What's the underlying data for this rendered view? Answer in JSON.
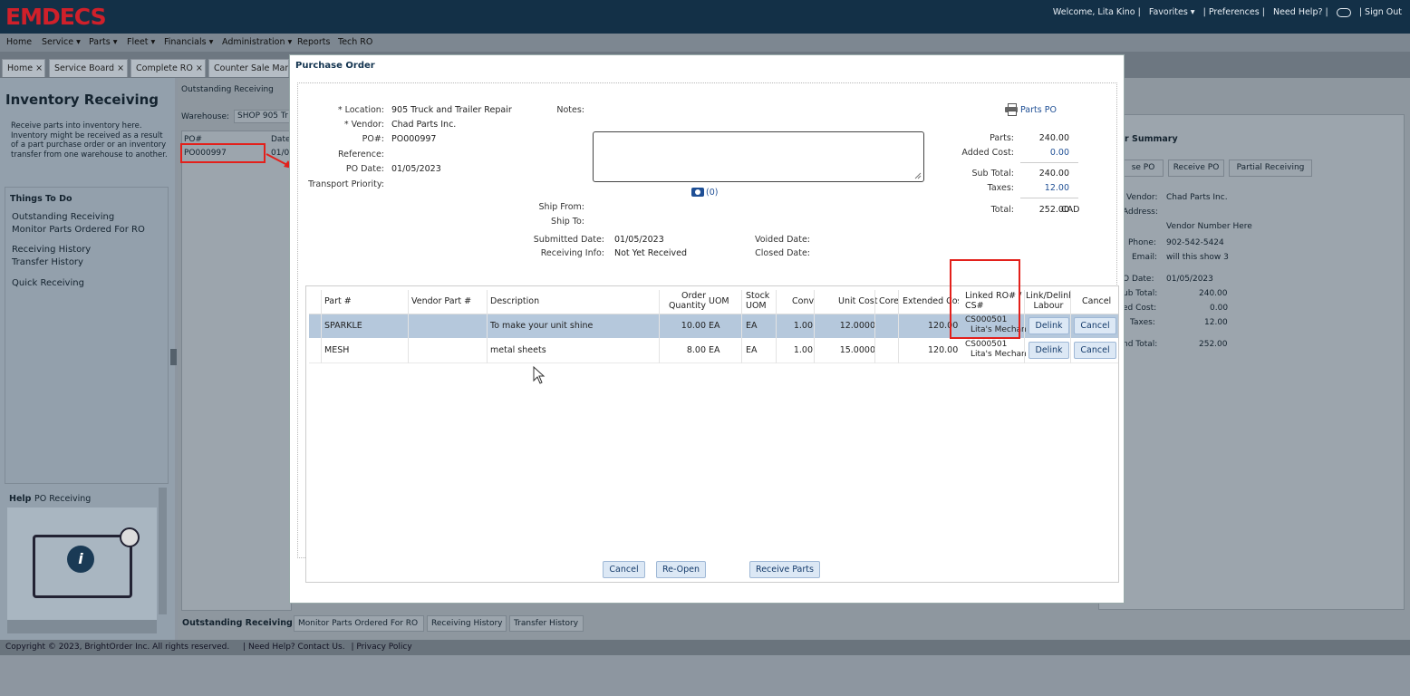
{
  "app": {
    "logo": "EMDECS"
  },
  "header": {
    "welcome": "Welcome, Lita Kino |",
    "favorites": "Favorites ▾",
    "preferences": "| Preferences |",
    "help": "Need Help? |",
    "signout": "| Sign Out"
  },
  "nav": [
    "Home",
    "Service ▾",
    "Parts ▾",
    "Fleet ▾",
    "Financials ▾",
    "Administration ▾",
    "Reports",
    "Tech RO"
  ],
  "tabs": [
    "Home ×",
    "Service Board ×",
    "Complete RO ×",
    "Counter Sale Mana"
  ],
  "left": {
    "title": "Inventory Receiving",
    "intro": "Receive parts into inventory here. Inventory might be received as a result of a part purchase order or an inventory transfer from one warehouse to another.",
    "things_title": "Things To Do",
    "links": [
      "Outstanding Receiving",
      "Monitor Parts Ordered For RO",
      "Receiving History",
      "Transfer History",
      "Quick Receiving"
    ],
    "help_title": "Help",
    "help_topic": "PO Receiving"
  },
  "main": {
    "radio_label": "Outstanding Receiving",
    "warehouse_label": "Warehouse:",
    "warehouse_value": "SHOP 905 Tr",
    "col_po": "PO#",
    "col_date": "Date",
    "po_value": "PO000997",
    "date_value": "01/0",
    "bottom_tabs": [
      "Outstanding Receiving",
      "Monitor Parts Ordered For RO",
      "Receiving History",
      "Transfer History"
    ]
  },
  "summary": {
    "title": "r Summary",
    "buttons": [
      "se PO",
      "Receive PO",
      "Partial Receiving"
    ],
    "vendor_label": "Vendor:",
    "vendor_value": "Chad Parts Inc.",
    "address_label": "Address:",
    "vendor_number": "Vendor Number Here",
    "phone_label": "Phone:",
    "phone_value": "902-542-5424",
    "email_label": "Email:",
    "email_value": "will this show 3",
    "podate_label": "O Date:",
    "podate_value": "01/05/2023",
    "subtotal_label": "ub Total:",
    "subtotal_value": "240.00",
    "addcost_label": "ed Cost:",
    "addcost_value": "0.00",
    "taxes_label": "Taxes:",
    "taxes_value": "12.00",
    "grand_label": "nd Total:",
    "grand_value": "252.00"
  },
  "footer": {
    "copyright": "Copyright © 2023, BrightOrder Inc. All rights reserved.",
    "help": "| Need Help? Contact Us.",
    "privacy": "| Privacy Policy"
  },
  "modal": {
    "title": "Purchase Order",
    "location_label": "* Location:",
    "location_value": "905 Truck and Trailer Repair",
    "vendor_label": "* Vendor:",
    "vendor_value": "Chad Parts Inc.",
    "po_label": "PO#:",
    "po_value": "PO000997",
    "reference_label": "Reference:",
    "podate_label": "PO Date:",
    "podate_value": "01/05/2023",
    "transport_label": "Transport Priority:",
    "notes_label": "Notes:",
    "attach_count": "(0)",
    "shipfrom_label": "Ship From:",
    "shipto_label": "Ship To:",
    "submitted_label": "Submitted Date:",
    "submitted_value": "01/05/2023",
    "receiving_label": "Receiving Info:",
    "receiving_value": "Not Yet Received",
    "voided_label": "Voided Date:",
    "closed_label": "Closed Date:",
    "parts_po_link": "Parts PO",
    "totals": {
      "parts_label": "Parts:",
      "parts_value": "240.00",
      "added_label": "Added Cost:",
      "added_value": "0.00",
      "subtotal_label": "Sub Total:",
      "subtotal_value": "240.00",
      "taxes_label": "Taxes:",
      "taxes_value": "12.00",
      "total_label": "Total:",
      "total_value": "252.00",
      "currency": "CAD"
    },
    "columns": {
      "part": "Part #",
      "vendor_part": "Vendor Part #",
      "description": "Description",
      "order_qty_1": "Order",
      "order_qty_2": "Quantity",
      "uom": "UOM",
      "stock_uom_1": "Stock",
      "stock_uom_2": "UOM",
      "conv": "Conv",
      "unit_cost": "Unit Cost",
      "core": "Core",
      "extended": "Extended Cost",
      "linked_1": "Linked RO# /",
      "linked_2": "CS#",
      "link_1": "Link/Delink",
      "link_2": "Labour",
      "cancel": "Cancel"
    },
    "rows": [
      {
        "part": "SPARKLE",
        "vendor_part": "",
        "description": "To make your unit shine",
        "qty": "10.00",
        "uom": "EA",
        "stock_uom": "EA",
        "conv": "1.00",
        "unit_cost": "12.0000",
        "core": "",
        "extended": "120.00",
        "linked_ro": "CS000501",
        "linked_name": "Lita's Mechan",
        "link_btn": "Delink",
        "cancel_btn": "Cancel"
      },
      {
        "part": "MESH",
        "vendor_part": "",
        "description": "metal sheets",
        "qty": "8.00",
        "uom": "EA",
        "stock_uom": "EA",
        "conv": "1.00",
        "unit_cost": "15.0000",
        "core": "",
        "extended": "120.00",
        "linked_ro": "CS000501",
        "linked_name": "Lita's Mechan",
        "link_btn": "Delink",
        "cancel_btn": "Cancel"
      }
    ],
    "buttons": {
      "cancel": "Cancel",
      "reopen": "Re-Open",
      "receive": "Receive Parts"
    }
  },
  "colors": {
    "topbar": "#133047",
    "logo": "#d0202a",
    "highlight": "#e3201b",
    "selected_row": "#b5c8dc"
  }
}
